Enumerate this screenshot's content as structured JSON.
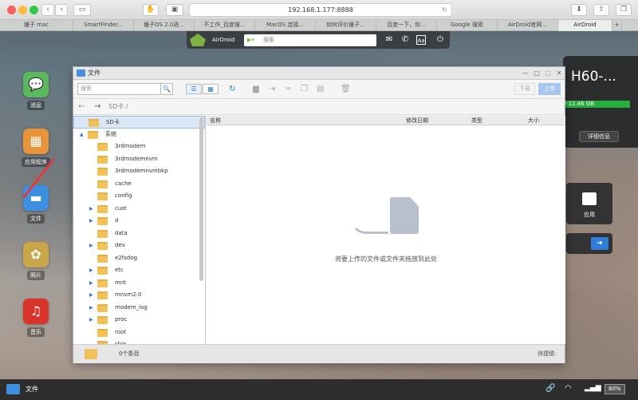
{
  "browser": {
    "address": "192.168.1.177:8888",
    "tabs": [
      "锤子 mac",
      "SmartFinder...",
      "锤子OS 2.0进...",
      "不工作_百度搜...",
      "MacOS 连接...",
      "如何评价锤子...",
      "百度一下，你...",
      "Google 搜索",
      "AirDroid官网...",
      "AirDroid"
    ],
    "new_tab": "+"
  },
  "airdroid": {
    "brand": "AirDroid",
    "search_placeholder": "搜索"
  },
  "dock": [
    {
      "label": "消息",
      "icon": "messages-icon",
      "color": "#5cb85c"
    },
    {
      "label": "应用程序",
      "icon": "apps-icon",
      "color": "#e8943a"
    },
    {
      "label": "文件",
      "icon": "files-icon",
      "color": "#3d8fe0"
    },
    {
      "label": "照片",
      "icon": "photos-icon",
      "color": "#c9a64a"
    },
    {
      "label": "音乐",
      "icon": "music-icon",
      "color": "#d9342b"
    }
  ],
  "device": {
    "name": "H60-...",
    "storage": "/ 11.46 GB",
    "detail_label": "详细信息"
  },
  "app_widget_label": "应用",
  "file_window": {
    "title": "文件",
    "search_placeholder": "搜索",
    "download_label": "下载",
    "upload_label": "上传",
    "path": "SD卡  /",
    "tree": [
      {
        "name": "SD卡",
        "level": 0,
        "selected": true,
        "arrow": ""
      },
      {
        "name": "系统",
        "level": 0,
        "selected": false,
        "arrow": "▲"
      },
      {
        "name": "3rdmodem",
        "level": 1,
        "arrow": ""
      },
      {
        "name": "3rdmodemnvm",
        "level": 1,
        "arrow": ""
      },
      {
        "name": "3rdmodemnvmbkp",
        "level": 1,
        "arrow": ""
      },
      {
        "name": "cache",
        "level": 1,
        "arrow": ""
      },
      {
        "name": "config",
        "level": 1,
        "arrow": ""
      },
      {
        "name": "cust",
        "level": 1,
        "arrow": "▶"
      },
      {
        "name": "d",
        "level": 1,
        "arrow": "▶"
      },
      {
        "name": "data",
        "level": 1,
        "arrow": ""
      },
      {
        "name": "dev",
        "level": 1,
        "arrow": "▶"
      },
      {
        "name": "e2fsdog",
        "level": 1,
        "arrow": ""
      },
      {
        "name": "etc",
        "level": 1,
        "arrow": "▶"
      },
      {
        "name": "mnt",
        "level": 1,
        "arrow": "▶"
      },
      {
        "name": "mnvm2:0",
        "level": 1,
        "arrow": "▶"
      },
      {
        "name": "modem_log",
        "level": 1,
        "arrow": "▶"
      },
      {
        "name": "proc",
        "level": 1,
        "arrow": "▶"
      },
      {
        "name": "root",
        "level": 1,
        "arrow": ""
      },
      {
        "name": "sbin",
        "level": 1,
        "arrow": ""
      }
    ],
    "columns": [
      "名称",
      "修改日期",
      "类型",
      "大小"
    ],
    "empty_hint": "将要上传的文件或文件夹拖放到此处",
    "item_count": "0个条目",
    "shortcut_label": "快捷键:"
  },
  "taskbar": {
    "active_label": "文件",
    "battery": "80%"
  }
}
